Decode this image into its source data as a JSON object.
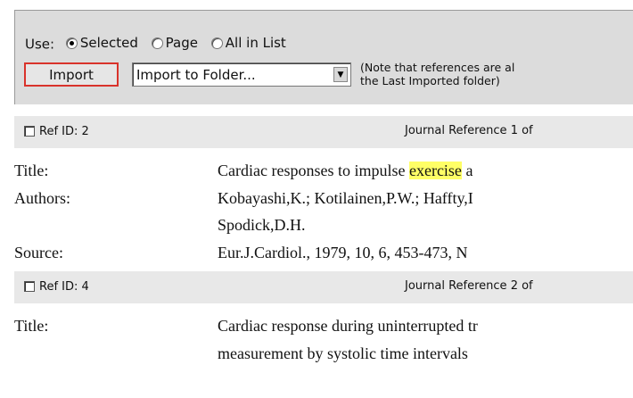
{
  "toolbar": {
    "use_label": "Use:",
    "options": [
      "Selected",
      "Page",
      "All in List"
    ],
    "import_label": "Import",
    "folder_select": "Import to Folder...",
    "note_line1": "(Note that references are al",
    "note_line2": "the Last Imported folder)"
  },
  "refs": [
    {
      "ref_id": "Ref ID: 2",
      "journal_ref": "Journal Reference 1 of",
      "title_label": "Title:",
      "title_before": "Cardiac responses to impulse ",
      "title_highlight": "exercise",
      "title_after": " a",
      "authors_label": "Authors:",
      "authors_line1": "Kobayashi,K.; Kotilainen,P.W.; Haffty,I",
      "authors_line2": "Spodick,D.H.",
      "source_label": "Source:",
      "source": "Eur.J.Cardiol., 1979, 10, 6, 453-473, N"
    },
    {
      "ref_id": "Ref ID: 4",
      "journal_ref": "Journal Reference 2 of",
      "title_label": "Title:",
      "title_line1": "Cardiac response during uninterrupted tr",
      "title_line2": "measurement by systolic time intervals"
    }
  ],
  "colors": {
    "highlight": "#ffff66",
    "button_border": "#d9332b"
  }
}
